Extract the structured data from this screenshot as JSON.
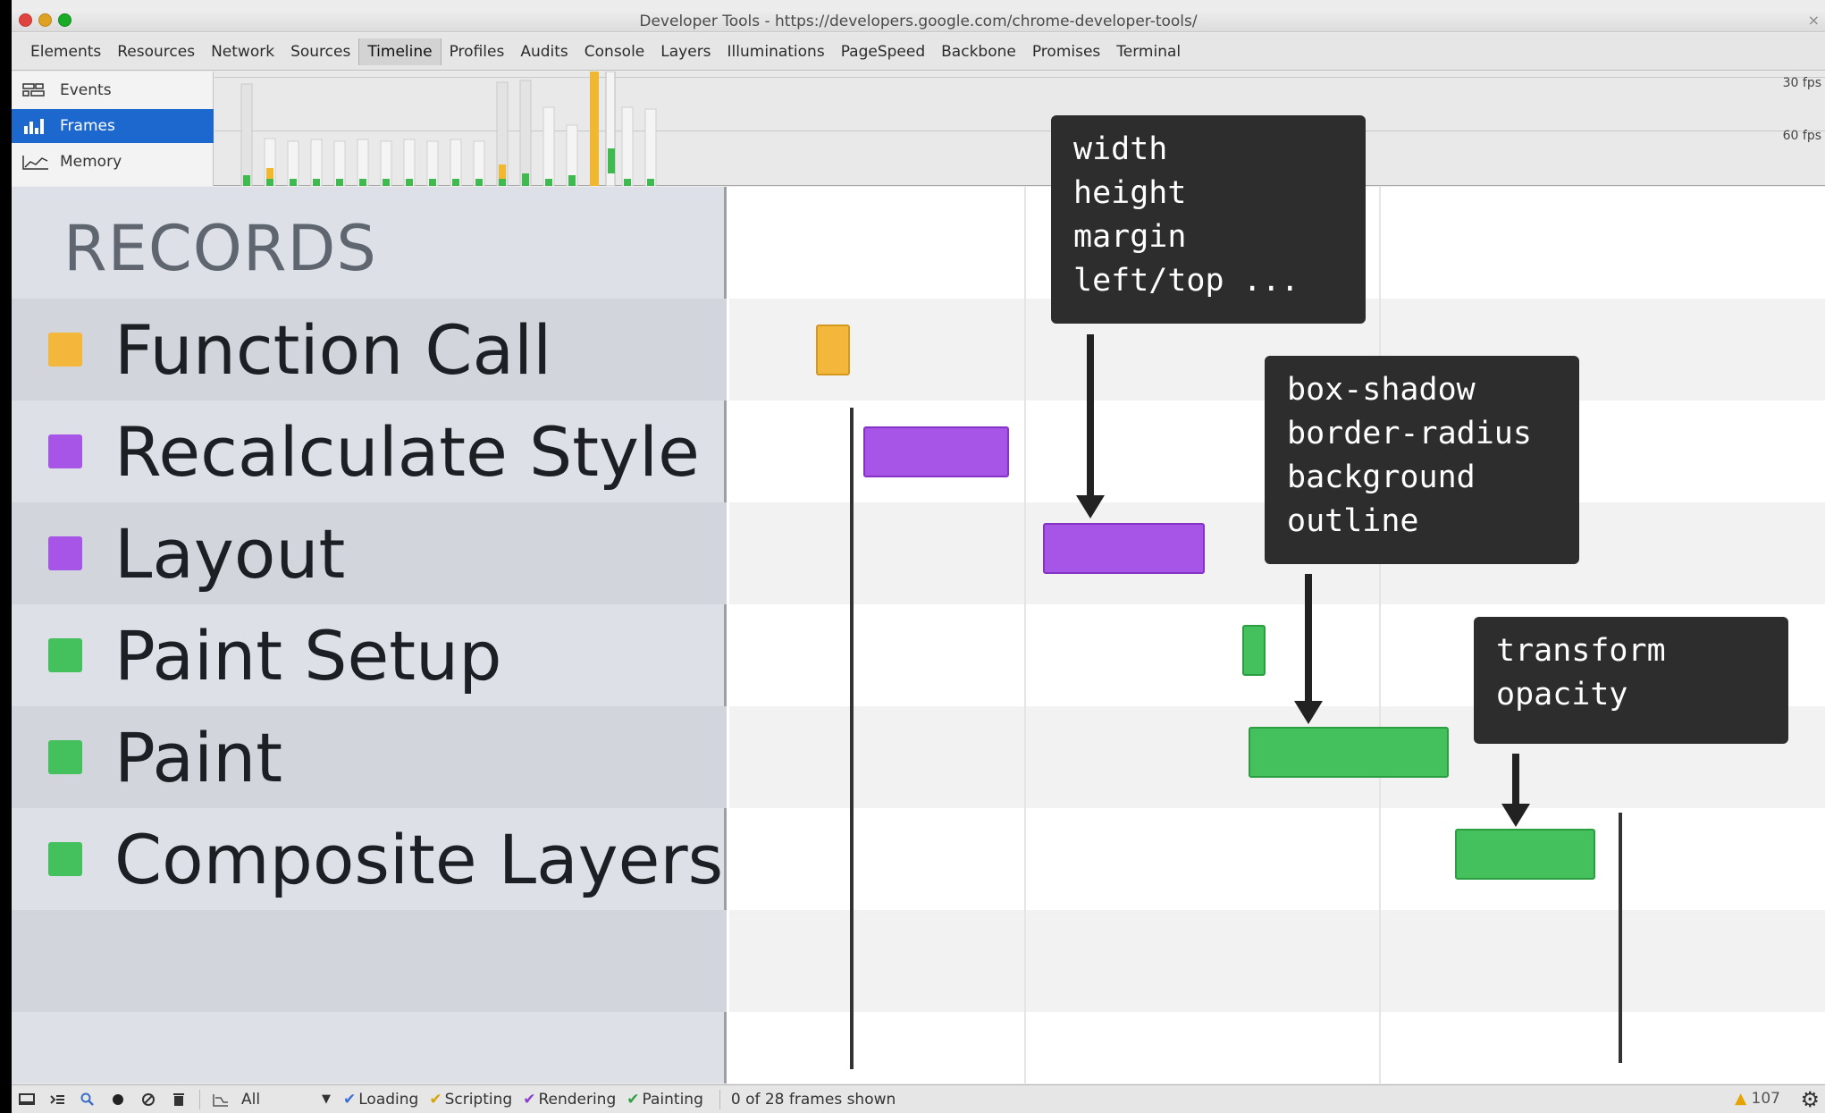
{
  "window": {
    "title": "Developer Tools - https://developers.google.com/chrome-developer-tools/",
    "close_glyph": "×"
  },
  "tabs": [
    {
      "label": "Elements",
      "active": false
    },
    {
      "label": "Resources",
      "active": false
    },
    {
      "label": "Network",
      "active": false
    },
    {
      "label": "Sources",
      "active": false
    },
    {
      "label": "Timeline",
      "active": true
    },
    {
      "label": "Profiles",
      "active": false
    },
    {
      "label": "Audits",
      "active": false
    },
    {
      "label": "Console",
      "active": false
    },
    {
      "label": "Layers",
      "active": false
    },
    {
      "label": "Illuminations",
      "active": false
    },
    {
      "label": "PageSpeed",
      "active": false
    },
    {
      "label": "Backbone",
      "active": false
    },
    {
      "label": "Promises",
      "active": false
    },
    {
      "label": "Terminal",
      "active": false
    }
  ],
  "overview": {
    "modes": {
      "events": {
        "label": "Events",
        "icon": "events-icon"
      },
      "frames": {
        "label": "Frames",
        "icon": "frames-bar-chart-icon",
        "selected": true
      },
      "memory": {
        "label": "Memory",
        "icon": "memory-graph-icon"
      }
    },
    "fps_30_label": "30 fps",
    "fps_60_label": "60 fps"
  },
  "records": {
    "title": "RECORDS",
    "items": [
      {
        "label": "Function Call",
        "color": "#f2b73b"
      },
      {
        "label": "Recalculate Style",
        "color": "#a655e6"
      },
      {
        "label": "Layout",
        "color": "#a655e6"
      },
      {
        "label": "Paint Setup",
        "color": "#44c15d"
      },
      {
        "label": "Paint",
        "color": "#44c15d"
      },
      {
        "label": "Composite Layers",
        "color": "#44c15d"
      }
    ]
  },
  "callouts": {
    "layout_props": [
      "width",
      "height",
      "margin",
      "left/top ..."
    ],
    "paint_props": [
      "box-shadow",
      "border-radius",
      "background",
      "outline"
    ],
    "composite_props": [
      "transform",
      "opacity"
    ]
  },
  "statusbar": {
    "filter_value": "All",
    "checkboxes": [
      {
        "label": "Loading",
        "color": "#3b6fd6"
      },
      {
        "label": "Scripting",
        "color": "#d9a400"
      },
      {
        "label": "Rendering",
        "color": "#8a3fd0"
      },
      {
        "label": "Painting",
        "color": "#2ea043"
      }
    ],
    "frames_summary": "0 of 28 frames shown",
    "warning_count": "107"
  },
  "colors": {
    "accent": "#1d68cf",
    "scripting": "#f2b73b",
    "rendering": "#a655e6",
    "painting": "#44c15d"
  }
}
